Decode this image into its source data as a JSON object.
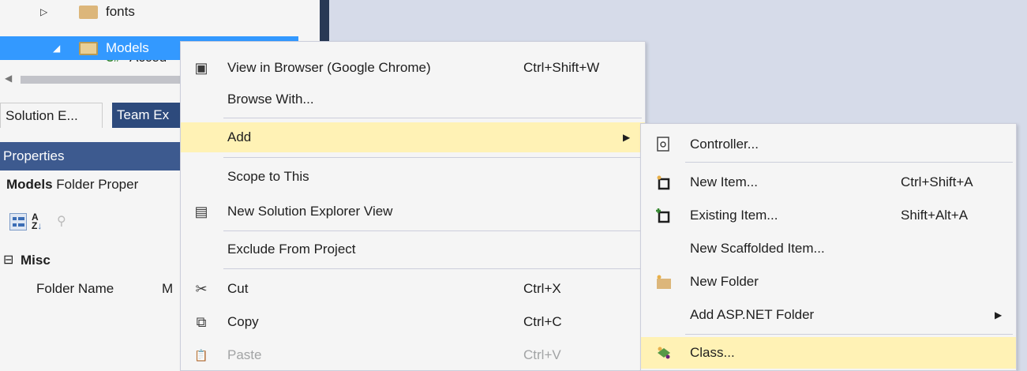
{
  "tree": {
    "items": [
      {
        "label": "fonts",
        "arrow": "▷"
      },
      {
        "label": "Models",
        "arrow": "◢"
      },
      {
        "label": "Accou",
        "icon": "C#"
      }
    ]
  },
  "tabs": [
    {
      "label": "Solution E..."
    },
    {
      "label": "Team Ex"
    }
  ],
  "properties": {
    "header": "Properties",
    "subject": "Models",
    "subtitle": "Folder Proper",
    "section": "Misc",
    "section_toggle": "⊟",
    "rows": [
      {
        "name": "Folder Name",
        "value": "M"
      }
    ]
  },
  "context_menu": {
    "items": [
      {
        "label": "View in Browser (Google Chrome)",
        "shortcut": "Ctrl+Shift+W",
        "icon": "browser-icon",
        "glyph": "▣"
      },
      {
        "label": "Browse With...",
        "shortcut": "",
        "icon": "",
        "glyph": ""
      },
      {
        "label": "Add",
        "shortcut": "",
        "icon": "",
        "glyph": "",
        "submenu_arrow": "▶"
      },
      {
        "label": "Scope to This",
        "shortcut": "",
        "icon": "",
        "glyph": ""
      },
      {
        "label": "New Solution Explorer View",
        "shortcut": "",
        "icon": "new-view-icon",
        "glyph": "▤"
      },
      {
        "label": "Exclude From Project",
        "shortcut": "",
        "icon": "",
        "glyph": ""
      },
      {
        "label": "Cut",
        "shortcut": "Ctrl+X",
        "icon": "scissors-icon",
        "glyph": "✂"
      },
      {
        "label": "Copy",
        "shortcut": "Ctrl+C",
        "icon": "copy-icon",
        "glyph": "⧉"
      },
      {
        "label": "Paste",
        "shortcut": "Ctrl+V",
        "icon": "paste-icon",
        "glyph": "📋",
        "disabled": true
      }
    ]
  },
  "add_submenu": {
    "items": [
      {
        "label": "Controller...",
        "shortcut": "",
        "icon": "controller-icon"
      },
      {
        "label": "New Item...",
        "shortcut": "Ctrl+Shift+A",
        "icon": "new-item-icon"
      },
      {
        "label": "Existing Item...",
        "shortcut": "Shift+Alt+A",
        "icon": "existing-item-icon"
      },
      {
        "label": "New Scaffolded Item...",
        "shortcut": "",
        "icon": ""
      },
      {
        "label": "New Folder",
        "shortcut": "",
        "icon": "new-folder-icon"
      },
      {
        "label": "Add ASP.NET Folder",
        "shortcut": "",
        "icon": "",
        "submenu_arrow": "▶"
      },
      {
        "label": "Class...",
        "shortcut": "",
        "icon": "class-icon"
      }
    ]
  },
  "colors": {
    "selection": "#3399ff",
    "hover": "#fff2b5",
    "menu_bg": "#f5f5f5",
    "ide_bg": "#d6dbe9"
  }
}
